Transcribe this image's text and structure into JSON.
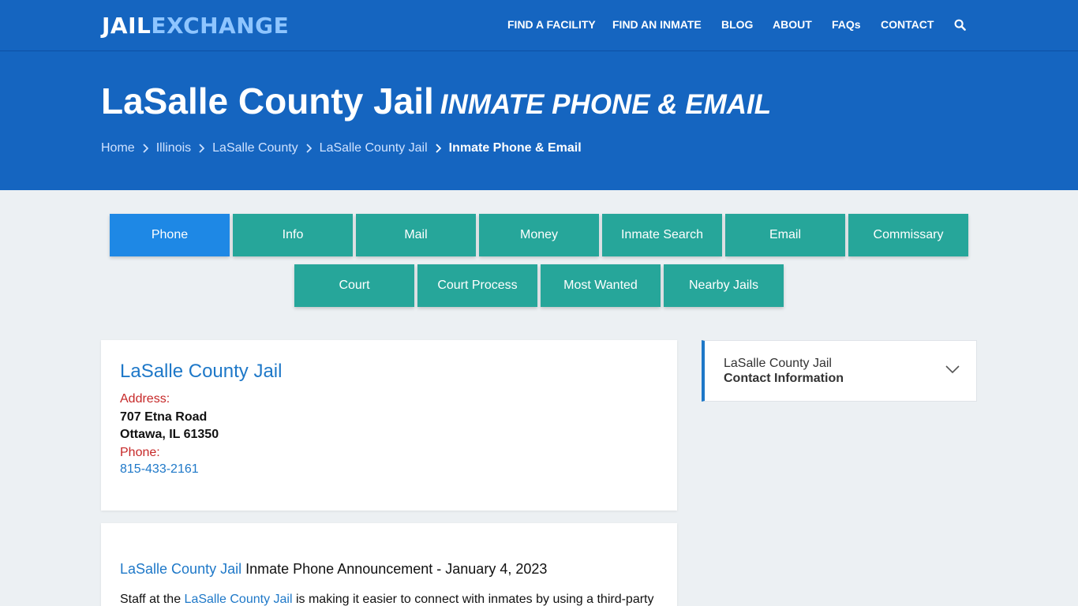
{
  "header": {
    "logo_part1": "JAIL",
    "logo_part2": "EXCHANGE",
    "nav": [
      "FIND A FACILITY",
      "FIND AN INMATE",
      "BLOG",
      "ABOUT",
      "FAQs",
      "CONTACT"
    ],
    "search_icon": "search-icon"
  },
  "hero": {
    "title": "LaSalle County Jail",
    "subtitle": "INMATE PHONE & EMAIL",
    "breadcrumb": [
      "Home",
      "Illinois",
      "LaSalle County",
      "LaSalle County Jail",
      "Inmate Phone & Email"
    ]
  },
  "tabs": {
    "row1": [
      "Phone",
      "Info",
      "Mail",
      "Money",
      "Inmate Search",
      "Email",
      "Commissary"
    ],
    "row2": [
      "Court",
      "Court Process",
      "Most Wanted",
      "Nearby Jails"
    ],
    "active": "Phone"
  },
  "facility": {
    "name": "LaSalle County Jail",
    "address_label": "Address:",
    "address_line1": "707 Etna Road",
    "address_line2": "Ottawa, IL 61350",
    "phone_label": "Phone:",
    "phone": "815-433-2161"
  },
  "announcement": {
    "link": "LaSalle County Jail",
    "heading": "Inmate Phone Announcement - January 4, 2023",
    "para_prefix": "Staff at the ",
    "para_link": "LaSalle County Jail",
    "para_suffix": " is making it easier to connect with inmates by using a third-party"
  },
  "sidebar": {
    "line1": "LaSalle County Jail",
    "line2": "Contact Information",
    "chevron_icon": "chevron-down-icon"
  },
  "colors": {
    "header_blue": "#1565c0",
    "tab_teal": "#26a69a",
    "tab_active": "#1e88e5",
    "link_blue": "#1e78c8",
    "label_red": "#c62828"
  }
}
